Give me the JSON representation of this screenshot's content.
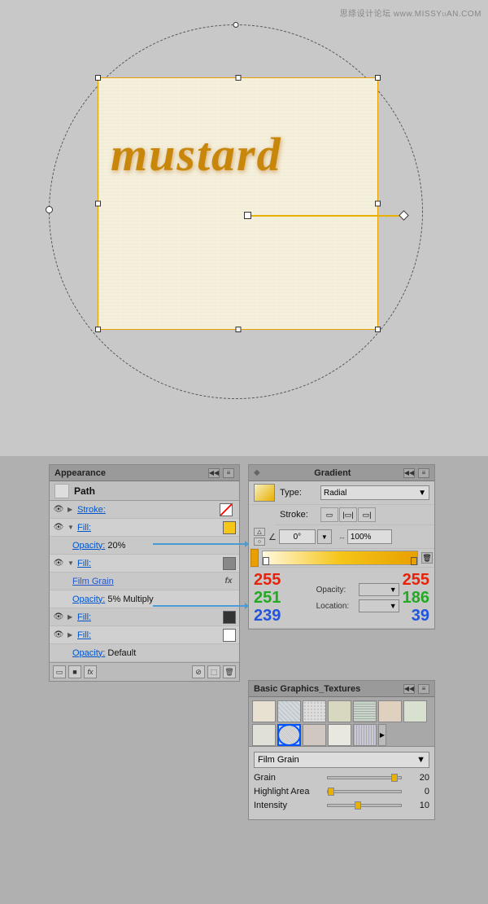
{
  "watermark": {
    "text": "思绦设计论坛 www.MISSY UAN.COM"
  },
  "canvas": {
    "mustard_text": "mustard"
  },
  "appearance_panel": {
    "title": "Appearance",
    "path_label": "Path",
    "rows": [
      {
        "type": "stroke",
        "label": "Stroke:",
        "has_swatch": true,
        "swatch_color": "red-slash"
      },
      {
        "type": "fill",
        "label": "Fill:",
        "has_swatch": true,
        "swatch_color": "#f5c518",
        "expanded": true
      },
      {
        "type": "opacity",
        "label": "Opacity:",
        "value": "20%"
      },
      {
        "type": "fill2",
        "label": "Fill:",
        "has_swatch": true,
        "swatch_color": "#888"
      },
      {
        "type": "filmgrain",
        "label": "Film Grain"
      },
      {
        "type": "opacity2",
        "label": "Opacity:",
        "value": "5% Multiply"
      },
      {
        "type": "fill3",
        "label": "Fill:",
        "has_swatch": true,
        "swatch_color": "#333"
      },
      {
        "type": "fill4",
        "label": "Fill:",
        "has_swatch": true,
        "swatch_color": "#fff"
      },
      {
        "type": "opacity3",
        "label": "Opacity:",
        "value": "Default"
      }
    ]
  },
  "gradient_panel": {
    "title": "Gradient",
    "type_label": "Type:",
    "type_value": "Radial",
    "stroke_label": "Stroke:",
    "angle_label": "0°",
    "scale_label": "100%",
    "rgb_left": {
      "r": "255",
      "g": "251",
      "b": "239"
    },
    "rgb_right": {
      "r": "255",
      "g": "186",
      "b": "39"
    },
    "opacity_label": "Opacity:",
    "location_label": "Location:"
  },
  "textures_panel": {
    "title": "Basic Graphics_Textures",
    "textures": [
      "t1",
      "t2",
      "t3",
      "t4",
      "t5",
      "t6",
      "t7",
      "t8",
      "t9",
      "t10",
      "t11",
      "t12"
    ],
    "selected_texture": "Film Grain",
    "dropdown_options": [
      "Film Grain"
    ],
    "grain_label": "Grain",
    "grain_value": "20",
    "highlight_label": "Highlight Area",
    "highlight_value": "0",
    "intensity_label": "Intensity",
    "intensity_value": "10"
  }
}
